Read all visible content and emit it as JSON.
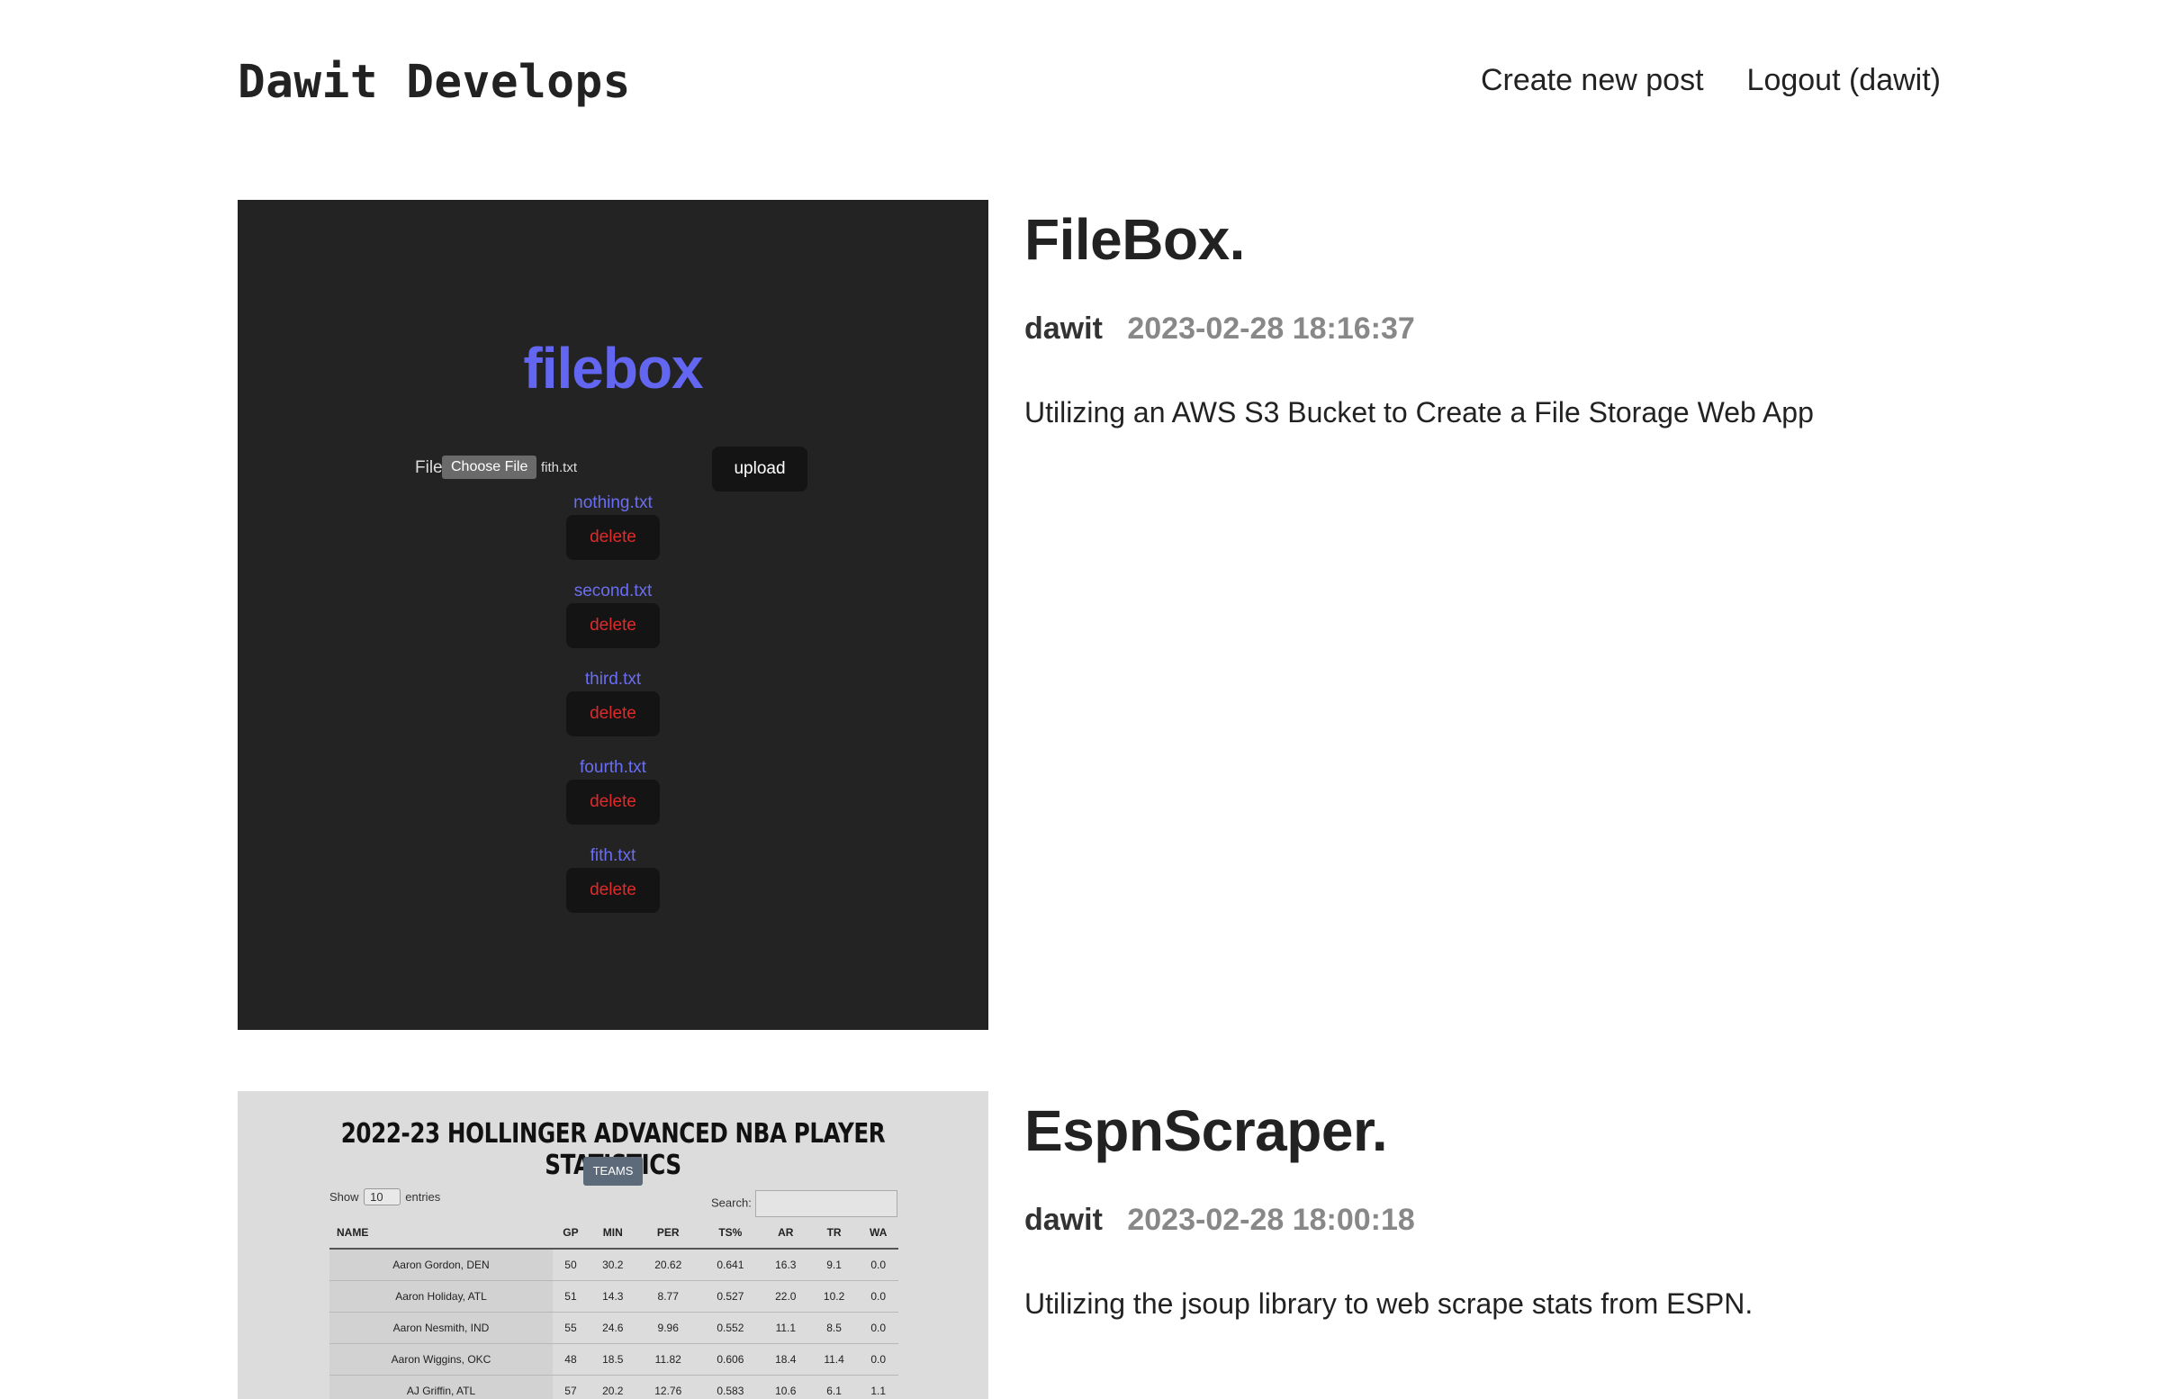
{
  "site": {
    "logo": "Dawit Develops",
    "nav": {
      "create": "Create new post",
      "logout": "Logout (dawit)"
    }
  },
  "posts": [
    {
      "title": "FileBox.",
      "author": "dawit",
      "time": "2023-02-28 18:16:37",
      "summary": "Utilizing an AWS S3 Bucket to Create a File Storage Web App",
      "image": {
        "brand": "filebox",
        "file_label": "File",
        "choose_label": "Choose File",
        "chosen_file": "fith.txt",
        "upload_label": "upload",
        "delete_label": "delete",
        "files": [
          "nothing.txt",
          "second.txt",
          "third.txt",
          "fourth.txt",
          "fith.txt"
        ],
        "colors": {
          "background": "#232323",
          "accent": "#6266f0",
          "delete": "#e02a2a"
        }
      }
    },
    {
      "title": "EspnScraper.",
      "author": "dawit",
      "time": "2023-02-28 18:00:18",
      "summary": "Utilizing the jsoup library to web scrape stats from ESPN.",
      "image": {
        "title": "2022-23 HOLLINGER ADVANCED NBA PLAYER STATISTICS",
        "teams_label": "TEAMS",
        "show_label": "Show",
        "show_value": "10",
        "entries_label": "entries",
        "search_label": "Search:",
        "columns": [
          "NAME",
          "GP",
          "MIN",
          "PER",
          "TS%",
          "AR",
          "TR",
          "WA"
        ],
        "rows": [
          [
            "Aaron Gordon, DEN",
            "50",
            "30.2",
            "20.62",
            "0.641",
            "16.3",
            "9.1",
            "0.0"
          ],
          [
            "Aaron Holiday, ATL",
            "51",
            "14.3",
            "8.77",
            "0.527",
            "22.0",
            "10.2",
            "0.0"
          ],
          [
            "Aaron Nesmith, IND",
            "55",
            "24.6",
            "9.96",
            "0.552",
            "11.1",
            "8.5",
            "0.0"
          ],
          [
            "Aaron Wiggins, OKC",
            "48",
            "18.5",
            "11.82",
            "0.606",
            "18.4",
            "11.4",
            "0.0"
          ],
          [
            "AJ Griffin, ATL",
            "57",
            "20.2",
            "12.76",
            "0.583",
            "10.6",
            "6.1",
            "1.1"
          ]
        ]
      }
    }
  ]
}
